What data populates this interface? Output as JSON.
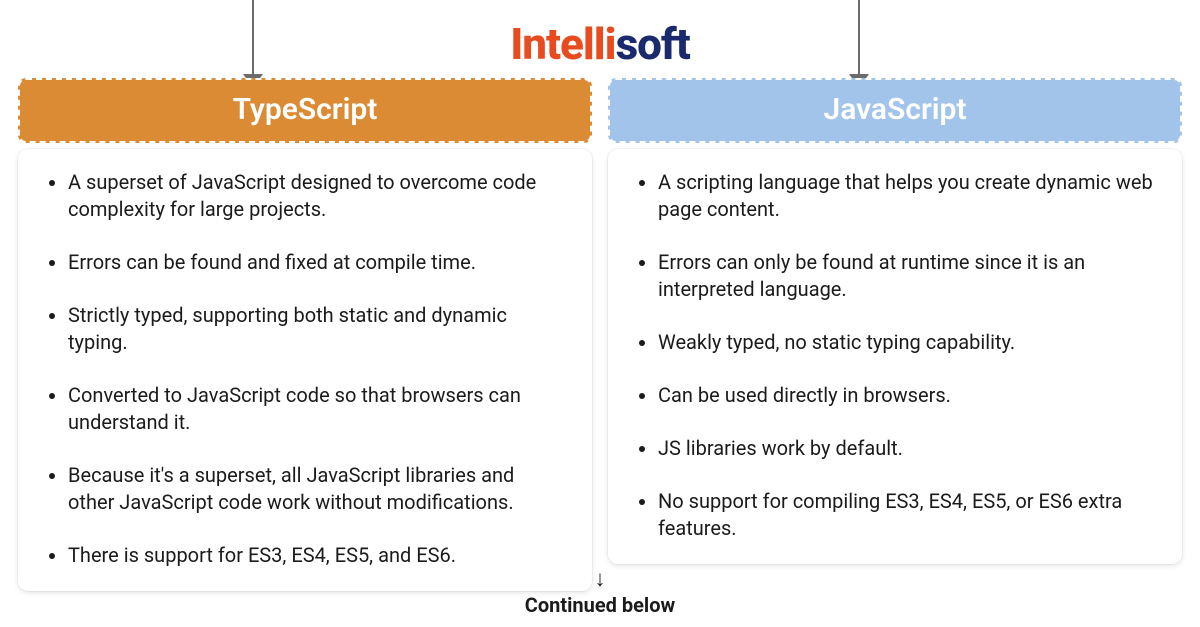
{
  "logo": {
    "part1": "Intelli",
    "part2": "soft"
  },
  "columns": [
    {
      "title": "TypeScript",
      "header_color": "#dc8b35",
      "points": [
        "A superset of JavaScript designed to overcome code complexity for large projects.",
        "Errors can be found and fixed at compile time.",
        "Strictly typed, supporting both static and dynamic typing.",
        "Converted to JavaScript code so that browsers can understand it.",
        "Because it's a superset, all JavaScript libraries and other JavaScript code work without modifications.",
        "There is support for ES3, ES4, ES5, and ES6."
      ]
    },
    {
      "title": "JavaScript",
      "header_color": "#a3c4ea",
      "points": [
        "A scripting language that helps you create dynamic web page content.",
        "Errors can only be found at runtime since it is an interpreted language.",
        "Weakly typed, no static typing capability.",
        "Can be used directly in browsers.",
        "JS libraries work by default.",
        "No support for compiling ES3, ES4, ES5, or ES6 extra features."
      ]
    }
  ],
  "footer": {
    "arrow": "↓",
    "label": "Continued below"
  }
}
